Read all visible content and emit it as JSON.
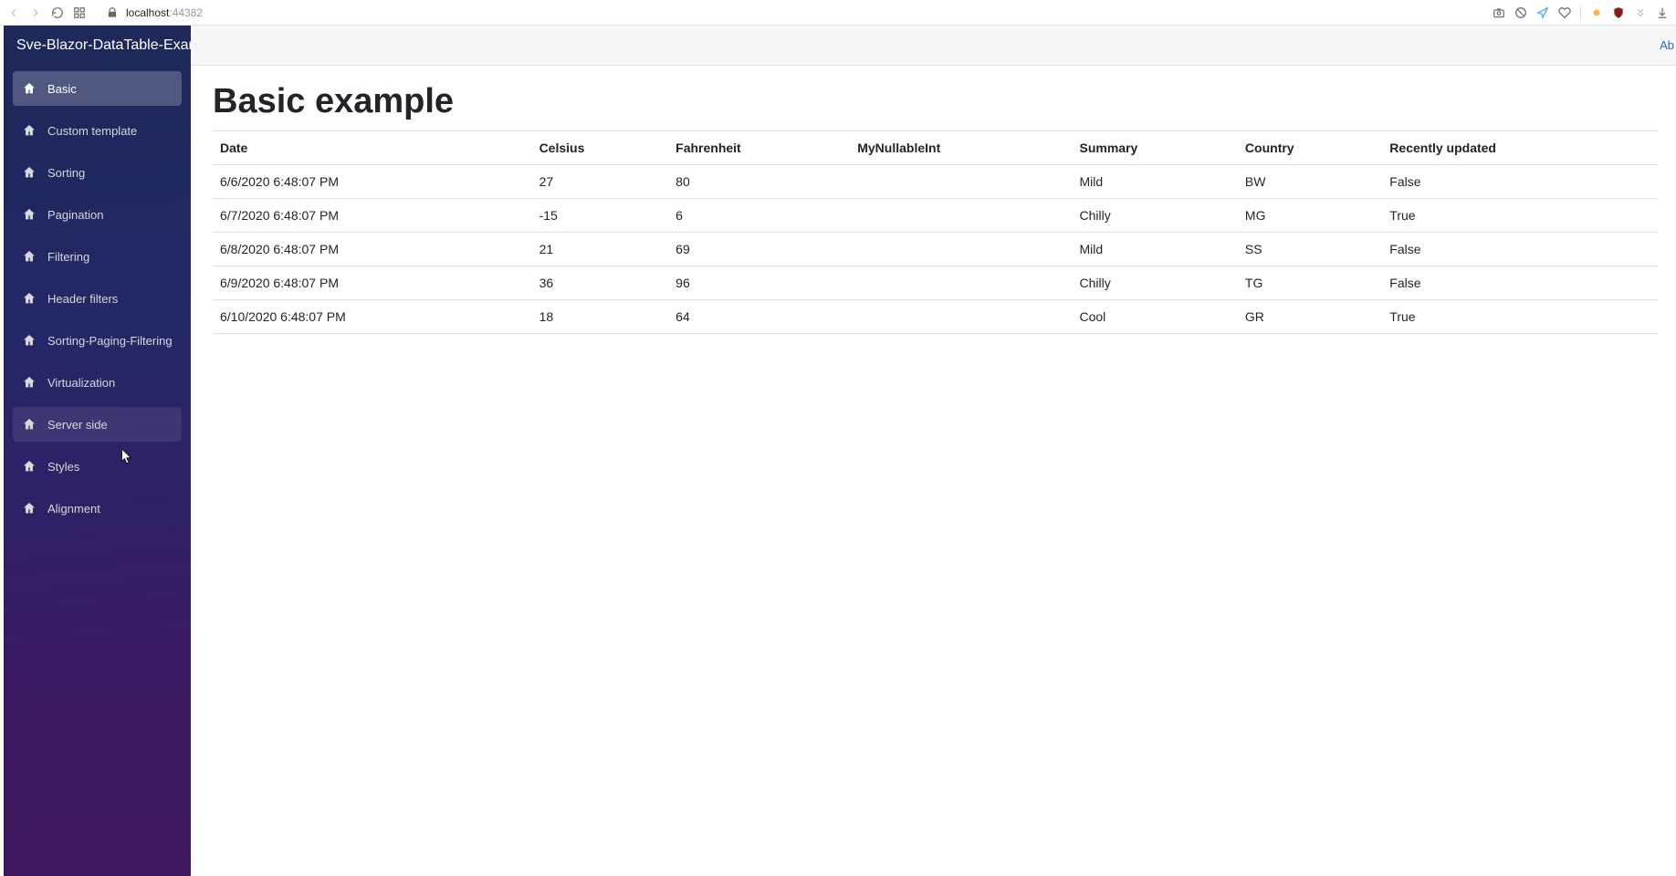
{
  "browser": {
    "host": "localhost",
    "port": ":44382",
    "about_link": "Ab"
  },
  "sidebar": {
    "title": "Sve-Blazor-DataTable-Exampl",
    "items": [
      {
        "label": "Basic",
        "state": "active"
      },
      {
        "label": "Custom template",
        "state": ""
      },
      {
        "label": "Sorting",
        "state": ""
      },
      {
        "label": "Pagination",
        "state": ""
      },
      {
        "label": "Filtering",
        "state": ""
      },
      {
        "label": "Header filters",
        "state": ""
      },
      {
        "label": "Sorting-Paging-Filtering",
        "state": ""
      },
      {
        "label": "Virtualization",
        "state": ""
      },
      {
        "label": "Server side",
        "state": "hover"
      },
      {
        "label": "Styles",
        "state": ""
      },
      {
        "label": "Alignment",
        "state": ""
      }
    ]
  },
  "page": {
    "title": "Basic example"
  },
  "table": {
    "columns": [
      "Date",
      "Celsius",
      "Fahrenheit",
      "MyNullableInt",
      "Summary",
      "Country",
      "Recently updated"
    ],
    "rows": [
      {
        "date": "6/6/2020 6:48:07 PM",
        "celsius": "27",
        "fahrenheit": "80",
        "nullable": "",
        "summary": "Mild",
        "country": "BW",
        "updated": "False"
      },
      {
        "date": "6/7/2020 6:48:07 PM",
        "celsius": "-15",
        "fahrenheit": "6",
        "nullable": "",
        "summary": "Chilly",
        "country": "MG",
        "updated": "True"
      },
      {
        "date": "6/8/2020 6:48:07 PM",
        "celsius": "21",
        "fahrenheit": "69",
        "nullable": "",
        "summary": "Mild",
        "country": "SS",
        "updated": "False"
      },
      {
        "date": "6/9/2020 6:48:07 PM",
        "celsius": "36",
        "fahrenheit": "96",
        "nullable": "",
        "summary": "Chilly",
        "country": "TG",
        "updated": "False"
      },
      {
        "date": "6/10/2020 6:48:07 PM",
        "celsius": "18",
        "fahrenheit": "64",
        "nullable": "",
        "summary": "Cool",
        "country": "GR",
        "updated": "True"
      }
    ]
  }
}
